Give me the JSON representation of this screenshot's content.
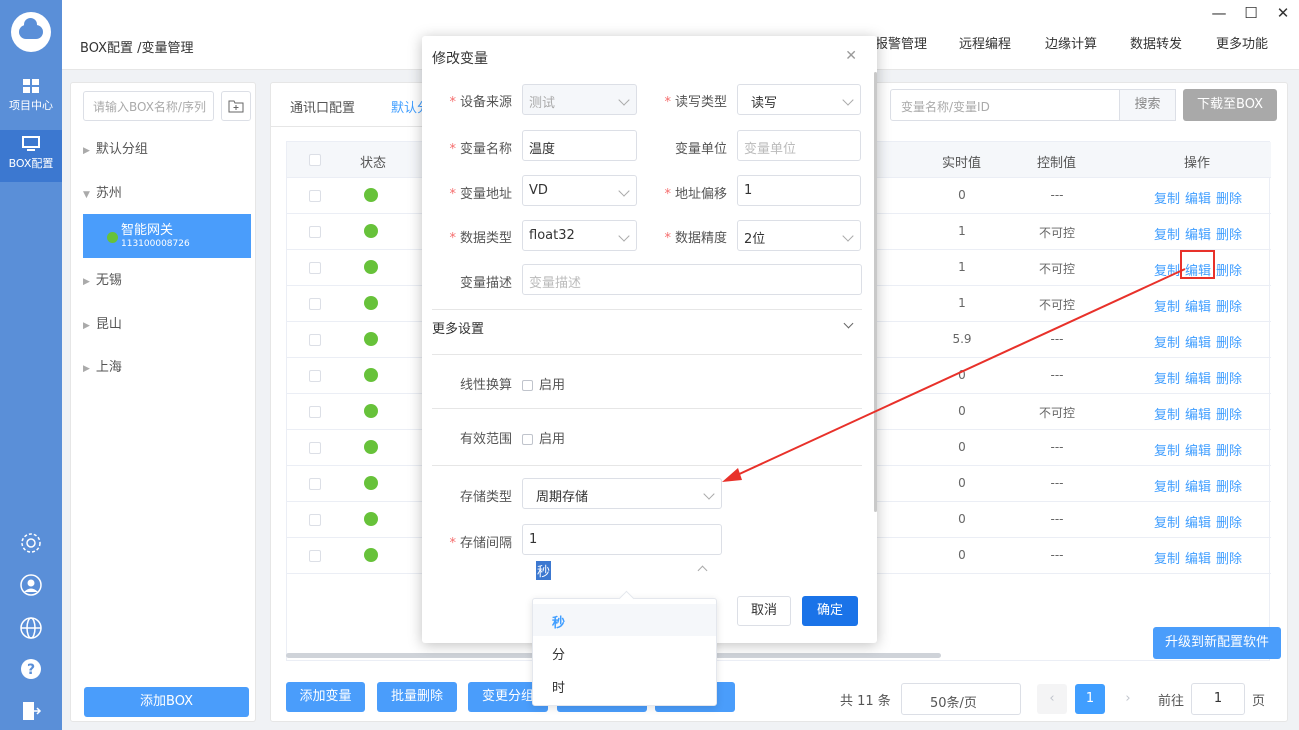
{
  "breadcrumb": "BOX配置 /变量管理",
  "top_nav": [
    "报警管理",
    "远程编程",
    "边缘计算",
    "数据转发",
    "更多功能"
  ],
  "window_controls": [
    "—",
    "☐",
    "✕"
  ],
  "rail": {
    "items": [
      {
        "label": "项目中心"
      },
      {
        "label": "BOX配置"
      }
    ]
  },
  "tree": {
    "search_placeholder": "请输入BOX名称/序列",
    "nodes": [
      "默认分组",
      "苏州",
      "无锡",
      "昆山",
      "上海"
    ],
    "selected": {
      "name": "智能网关",
      "serial": "113100008726"
    },
    "add_button": "添加BOX"
  },
  "main": {
    "tabs": [
      "通讯口配置",
      "默认分"
    ],
    "search_placeholder": "变量名称/变量ID",
    "search_button": "搜索",
    "download_button": "下载至BOX",
    "headers": {
      "status": "状态",
      "realtime": "实时值",
      "control": "控制值",
      "ops": "操作"
    },
    "rows": [
      {
        "realtime": "0",
        "control": "---"
      },
      {
        "realtime": "1",
        "control": "不可控"
      },
      {
        "realtime": "1",
        "control": "不可控"
      },
      {
        "realtime": "1",
        "control": "不可控"
      },
      {
        "realtime": "5.9",
        "control": "---"
      },
      {
        "realtime": "0",
        "control": "---"
      },
      {
        "realtime": "0",
        "control": "不可控"
      },
      {
        "realtime": "0",
        "control": "---"
      },
      {
        "realtime": "0",
        "control": "---"
      },
      {
        "realtime": "0",
        "control": "---"
      },
      {
        "realtime": "0",
        "control": "---"
      }
    ],
    "ops": {
      "copy": "复制",
      "edit": "编辑",
      "delete": "删除"
    },
    "upgrade_button": "升级到新配置软件",
    "bottom_buttons": [
      "添加变量",
      "批量删除",
      "变更分组"
    ],
    "pager": {
      "total": "共 11 条",
      "size": "50条/页",
      "current": "1",
      "goto": "前往",
      "goto_value": "1",
      "page_suffix": "页"
    }
  },
  "modal": {
    "title": "修改变量",
    "fields": {
      "device_source": {
        "label": "设备来源",
        "value": "测试"
      },
      "rw_type": {
        "label": "读写类型",
        "value": "读写"
      },
      "var_name": {
        "label": "变量名称",
        "value": "温度"
      },
      "var_unit": {
        "label": "变量单位",
        "placeholder": "变量单位"
      },
      "var_addr": {
        "label": "变量地址",
        "value": "VD"
      },
      "addr_offset": {
        "label": "地址偏移",
        "value": "1"
      },
      "data_type": {
        "label": "数据类型",
        "value": "float32"
      },
      "precision": {
        "label": "数据精度",
        "value": "2位"
      },
      "desc": {
        "label": "变量描述",
        "placeholder": "变量描述"
      }
    },
    "more_settings": "更多设置",
    "linear": {
      "label": "线性换算",
      "option": "启用"
    },
    "valid_range": {
      "label": "有效范围",
      "option": "启用"
    },
    "storage_type": {
      "label": "存储类型",
      "value": "周期存储"
    },
    "storage_interval": {
      "label": "存储间隔",
      "value": "1",
      "unit": "秒"
    },
    "cancel": "取消",
    "ok": "确定"
  },
  "unit_dropdown": [
    "秒",
    "分",
    "时"
  ],
  "colors": {
    "primary": "#4a9dfb",
    "rail": "#5a8fd8",
    "status_ok": "#67c23a",
    "highlight": "#e8312a"
  }
}
